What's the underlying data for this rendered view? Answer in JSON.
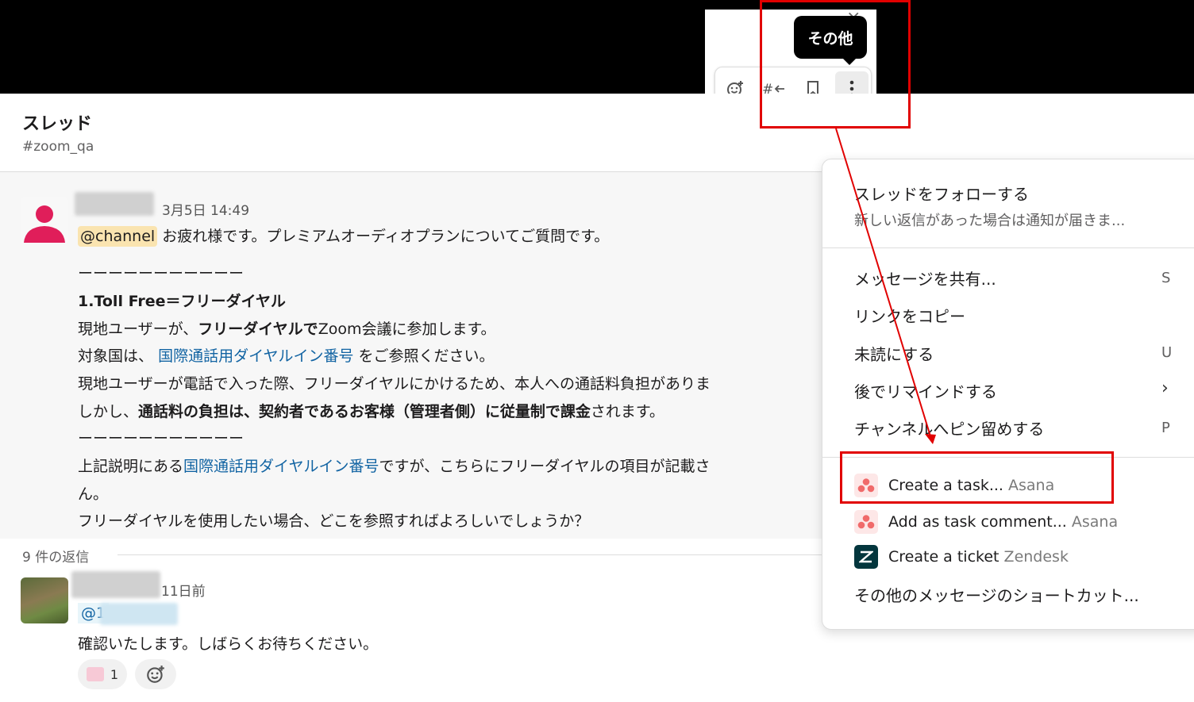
{
  "toolbar": {
    "tooltip": "その他",
    "close_glyph": "×",
    "buttons": [
      "add-reaction-icon",
      "reply-to-channel-icon",
      "bookmark-icon",
      "more-actions-icon"
    ]
  },
  "thread": {
    "title": "スレッド",
    "channel": "#zoom_qa"
  },
  "message": {
    "timestamp": "3月5日 14:49",
    "mention": "@channel",
    "first_line": "お疲れ様です。プレミアムオーディオプランについてご質問です。",
    "divider1": "ーーーーーーーーーーー",
    "heading": "1.Toll Free＝フリーダイヤル",
    "line2_a": "現地ユーザーが、",
    "line2_b": "フリーダイヤルで",
    "line2_c": "Zoom会議に参加します。",
    "line3_a": "対象国は、",
    "line3_link": "国際通話用ダイヤルイン番号",
    "line3_c": "をご参照ください。",
    "line4": "現地ユーザーが電話で入った際、フリーダイヤルにかけるため、本人への通話料負担がありま",
    "line5_a": "しかし、",
    "line5_b": "通話料の負担は、契約者であるお客様（管理者側）に従量制で課金",
    "line5_c": "されます。",
    "divider2": "ーーーーーーーーーーー",
    "line6_a": "上記説明にある",
    "line6_link": "国際通話用ダイヤルイン番号",
    "line6_c": "ですが、こちらにフリーダイヤルの項目が記載さ",
    "line7": "ん。",
    "line8": "フリーダイヤルを使用したい場合、どこを参照すればよろしいでしょうか？"
  },
  "replies": {
    "count_label": "9 件の返信",
    "first": {
      "timestamp": "11日前",
      "mention": "@1",
      "text": "確認いたします。しばらくお待ちください。",
      "reaction_count": "1"
    }
  },
  "menu": {
    "follow_title": "スレッドをフォローする",
    "follow_sub": "新しい返信があった場合は通知が届きま...",
    "items": [
      {
        "label": "メッセージを共有...",
        "shortcut": "S"
      },
      {
        "label": "リンクをコピー",
        "shortcut": ""
      },
      {
        "label": "未読にする",
        "shortcut": "U"
      },
      {
        "label": "後でリマインドする",
        "shortcut": "›"
      },
      {
        "label": "チャンネルへピン留めする",
        "shortcut": "P"
      }
    ],
    "apps": [
      {
        "label": "Create a task...",
        "source": "Asana"
      },
      {
        "label": "Add as task comment...",
        "source": "Asana"
      },
      {
        "label": "Create a ticket",
        "source": "Zendesk"
      }
    ],
    "more": "その他のメッセージのショートカット..."
  },
  "colors": {
    "highlight_red": "#e10000",
    "link_blue": "#1264a3",
    "mention_bg": "#fae4b0",
    "avatar_pink": "#e01e5a"
  }
}
